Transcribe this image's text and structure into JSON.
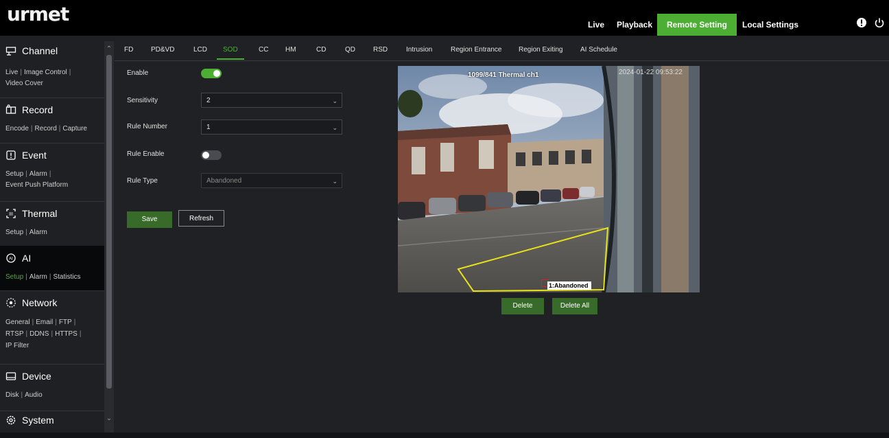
{
  "logo": "urmet",
  "top_nav": {
    "items": [
      "Live",
      "Playback",
      "Remote Setting",
      "Local Settings"
    ],
    "active": "Remote Setting"
  },
  "icons": {
    "info": "info-icon",
    "power": "power-icon"
  },
  "colors": {
    "accent": "#4caf33",
    "button": "#386b2a",
    "topbar": "#000000",
    "polygon": "#e8e21a"
  },
  "sidebar": {
    "sections": [
      {
        "label": "Channel",
        "icon": "channel-icon",
        "links": [
          "Live",
          "Image Control",
          "Video Cover"
        ]
      },
      {
        "label": "Record",
        "icon": "record-icon",
        "links": [
          "Encode",
          "Record",
          "Capture"
        ]
      },
      {
        "label": "Event",
        "icon": "event-icon",
        "links": [
          "Setup",
          "Alarm",
          "Event Push Platform"
        ]
      },
      {
        "label": "Thermal",
        "icon": "thermal-icon",
        "links": [
          "Setup",
          "Alarm"
        ]
      },
      {
        "label": "AI",
        "icon": "ai-icon",
        "links": [
          "Setup",
          "Alarm",
          "Statistics"
        ],
        "active": true,
        "selected_link": "Setup"
      },
      {
        "label": "Network",
        "icon": "network-icon",
        "links": [
          "General",
          "Email",
          "FTP",
          "RTSP",
          "DDNS",
          "HTTPS",
          "IP Filter"
        ]
      },
      {
        "label": "Device",
        "icon": "device-icon",
        "links": [
          "Disk",
          "Audio"
        ]
      },
      {
        "label": "System",
        "icon": "system-icon",
        "links": []
      }
    ]
  },
  "tabs": {
    "items": [
      "FD",
      "PD&VD",
      "LCD",
      "SOD",
      "CC",
      "HM",
      "CD",
      "QD",
      "RSD",
      "Intrusion",
      "Region Entrance",
      "Region Exiting",
      "AI Schedule"
    ],
    "active": "SOD"
  },
  "form": {
    "enable": {
      "label": "Enable",
      "value": true
    },
    "sensitivity": {
      "label": "Sensitivity",
      "value": "2"
    },
    "rule_number": {
      "label": "Rule Number",
      "value": "1"
    },
    "rule_enable": {
      "label": "Rule Enable",
      "value": false
    },
    "rule_type": {
      "label": "Rule Type",
      "value": "Abandoned",
      "disabled": true
    },
    "save_label": "Save",
    "refresh_label": "Refresh"
  },
  "video": {
    "title": "1099/841 Thermal ch1",
    "timestamp": "2024-01-22 09:53:22",
    "rule_label": "1:Abandoned"
  },
  "video_buttons": {
    "delete": "Delete",
    "delete_all": "Delete All"
  }
}
